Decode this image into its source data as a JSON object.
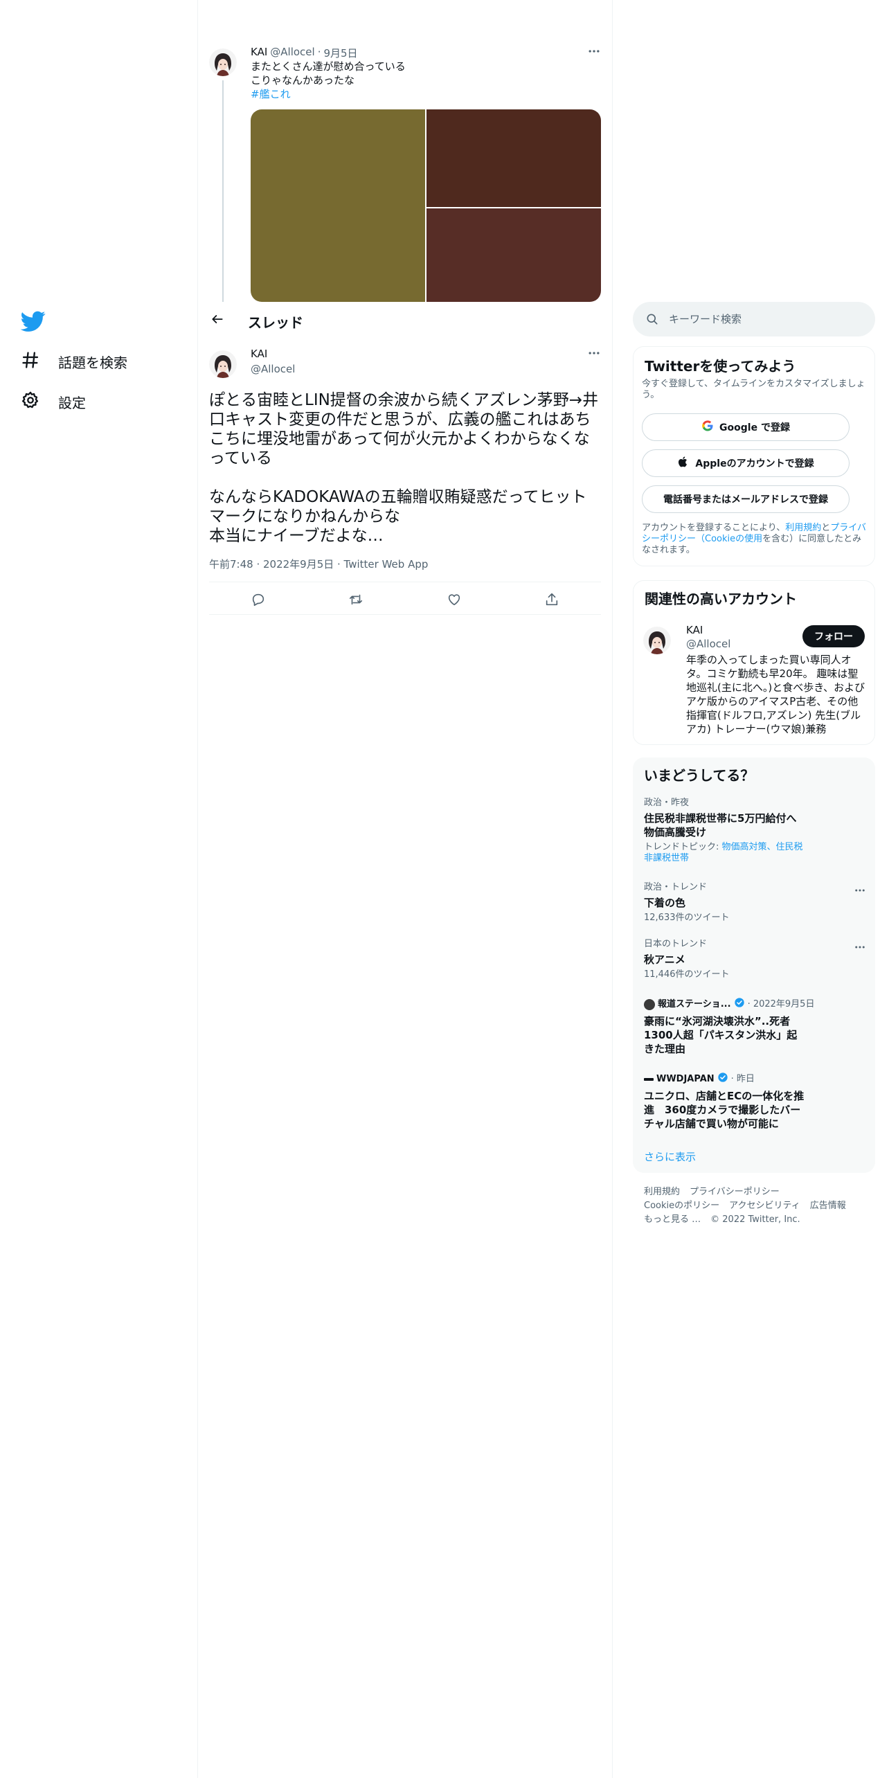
{
  "nav": {
    "items": [
      {
        "label": "話題を検索",
        "icon": "hashtag-icon"
      },
      {
        "label": "設定",
        "icon": "gear-icon"
      }
    ]
  },
  "parent_tweet": {
    "name": "KAI",
    "handle": "@Allocel",
    "separator": "·",
    "date": "9月5日",
    "lines": [
      "またとくさん達が慰め合っている",
      "こりゃなんかあったな"
    ],
    "hashtag": "#艦これ",
    "media_colors": [
      "#776a30",
      "#4f291e",
      "#572d26"
    ]
  },
  "thread_header": {
    "title": "スレッド"
  },
  "focal_tweet": {
    "name": "KAI",
    "handle": "@Allocel",
    "text": "ぽとる宙睦とLIN提督の余波から続くアズレン茅野→井口キャスト変更の件だと思うが、広義の艦これはあちこちに埋没地雷があって何が火元かよくわからなくなっている\n\nなんならKADOKAWAの五輪贈収賄疑惑だってヒットマークになりかねんからな\n本当にナイーブだよな…",
    "timestamp": "午前7:48 · 2022年9月5日 · Twitter Web App"
  },
  "search": {
    "placeholder": "キーワード検索"
  },
  "signup": {
    "title": "Twitterを使ってみよう",
    "subtitle": "今すぐ登録して、タイムラインをカスタマイズしましょう。",
    "google_label": "Google で登録",
    "apple_label": "Appleのアカウントで登録",
    "phone_label": "電話番号またはメールアドレスで登録",
    "legal_prefix": "アカウントを登録することにより、",
    "legal_terms": "利用規約",
    "legal_and": "と",
    "legal_privacy": "プライバシーポリシー",
    "legal_open": "（",
    "legal_cookie": "Cookieの使用",
    "legal_suffix": "を含む）に同意したとみなされます。"
  },
  "related": {
    "title": "関連性の高いアカウント",
    "name": "KAI",
    "handle": "@Allocel",
    "follow_label": "フォロー",
    "bio": "年季の入ってしまった買い専同人オタ。コミケ勤続も早20年。 趣味は聖地巡礼(主に北へ。)と食べ歩き、およびアケ版からのアイマスP古老、その他 指揮官(ドルフロ,アズレン) 先生(ブルアカ) トレーナー(ウマ娘)兼務"
  },
  "trends": {
    "title": "いまどうしてる？",
    "items": [
      {
        "context": "政治・昨夜",
        "title": "住民税非課税世帯に5万円給付へ 物価高騰受け",
        "topic_prefix": "トレンドトピック: ",
        "topic_links": "物価高対策、住民税非課税世帯"
      },
      {
        "context": "政治・トレンド",
        "title": "下着の色",
        "count": "12,633件のツイート"
      },
      {
        "context": "日本のトレンド",
        "title": "秋アニメ",
        "count": "11,446件のツイート"
      }
    ],
    "news": [
      {
        "source": "報道ステーショ...",
        "meta": "· 2022年9月5日",
        "title": "豪雨に“氷河湖決壊洪水”..死者1300人超「パキスタン洪水」起きた理由"
      },
      {
        "source": "WWDJAPAN",
        "meta": "· 昨日",
        "title": "ユニクロ、店舗とECの一体化を推進　360度カメラで撮影したバーチャル店舗で買い物が可能に"
      }
    ],
    "show_more": "さらに表示"
  },
  "footer": {
    "row1": [
      "利用規約",
      "プライバシーポリシー"
    ],
    "row2": [
      "Cookieのポリシー",
      "アクセシビリティ",
      "広告情報"
    ],
    "more": "もっと見る …",
    "copyright": "© 2022 Twitter, Inc."
  },
  "colors": {
    "accent": "#1d9bf0",
    "text": "#0f1419",
    "muted": "#536471",
    "border": "#eff3f4"
  }
}
